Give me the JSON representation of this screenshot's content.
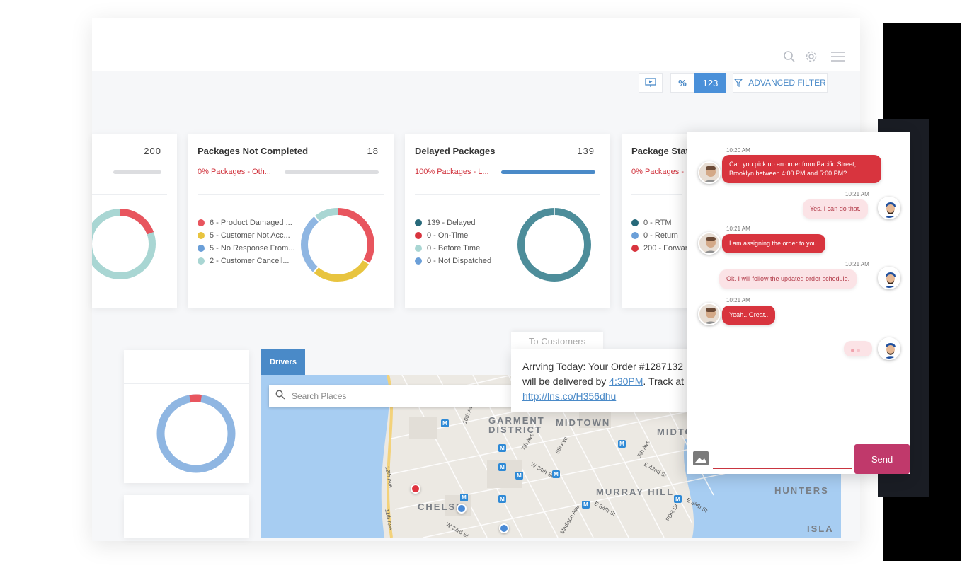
{
  "toolbar": {
    "percent_label": "%",
    "number_label": "123",
    "advanced_filter_label": "ADVANCED FILTER"
  },
  "cards": [
    {
      "count": "200"
    },
    {
      "title": "Packages Not Completed",
      "count": "18",
      "sub": "0% Packages - Oth...",
      "progress": 0,
      "legend": [
        {
          "label": "6 - Product Damaged ...",
          "color": "#e8555e"
        },
        {
          "label": "5 - Customer Not Acc...",
          "color": "#e8c43f"
        },
        {
          "label": "5 - No Response From...",
          "color": "#6b9fd8"
        },
        {
          "label": "2 - Customer Cancell...",
          "color": "#a9d6d3"
        }
      ]
    },
    {
      "title": "Delayed Packages",
      "count": "139",
      "sub": "100% Packages - L...",
      "progress": 1,
      "legend": [
        {
          "label": "139 - Delayed",
          "color": "#27697a"
        },
        {
          "label": "0 - On-Time",
          "color": "#d8343e"
        },
        {
          "label": "0 - Before Time",
          "color": "#a9d6d3"
        },
        {
          "label": "0 - Not Dispatched",
          "color": "#6b9fd8"
        }
      ]
    },
    {
      "title": "Package Stat",
      "sub": "0% Packages -",
      "legend": [
        {
          "label": "0 - RTM",
          "color": "#27697a"
        },
        {
          "label": "0 - Return",
          "color": "#6b9fd8"
        },
        {
          "label": "200 - Forwar",
          "color": "#d8343e"
        }
      ]
    }
  ],
  "map": {
    "tab_label": "Drivers",
    "search_placeholder": "Search Places",
    "labels": {
      "garment": "GARMENT",
      "district": "DISTRICT",
      "midtown": "MIDTOWN",
      "midtown2": "MIDTO",
      "murray": "MURRAY HILL",
      "chelsea": "CHELSE",
      "hunters": "HUNTERS",
      "isla": "ISLA"
    },
    "streets": {
      "s1": "12th Ave",
      "s2": "11th Ave",
      "s3": "10th Ave",
      "s4": "7th Ave",
      "s5": "W 34th St",
      "s6": "6th Ave",
      "s7": "5th Ave",
      "s8": "E 42nd St",
      "s9": "E 34th St",
      "s10": "Madison Ave",
      "s11": "FDR Dr",
      "s12": "E 38th St",
      "s13": "W 23rd St"
    }
  },
  "sms": {
    "tab": "To Customers",
    "line1": "Arrving Today: Your Order #1287132",
    "line2_pre": "will be delivered by ",
    "line2_time": "4:30PM",
    "line2_post": ". Track at",
    "link": "http://lns.co/H356dhu"
  },
  "chat": {
    "messages": [
      {
        "time": "10:20 AM",
        "text1": "Can you pick up an order from Pacific Street,",
        "text2": "Brooklyn between 4:00 PM and 5:00 PM?"
      },
      {
        "time": "10:21 AM",
        "text": "Yes. I can do that."
      },
      {
        "time": "10:21 AM",
        "text": "I am assigning the order to you."
      },
      {
        "time": "10:21 AM",
        "text": "Ok. I will follow the updated order schedule."
      },
      {
        "time": "10:21 AM",
        "text": "Yeah.. Great.."
      }
    ],
    "send_label": "Send"
  }
}
